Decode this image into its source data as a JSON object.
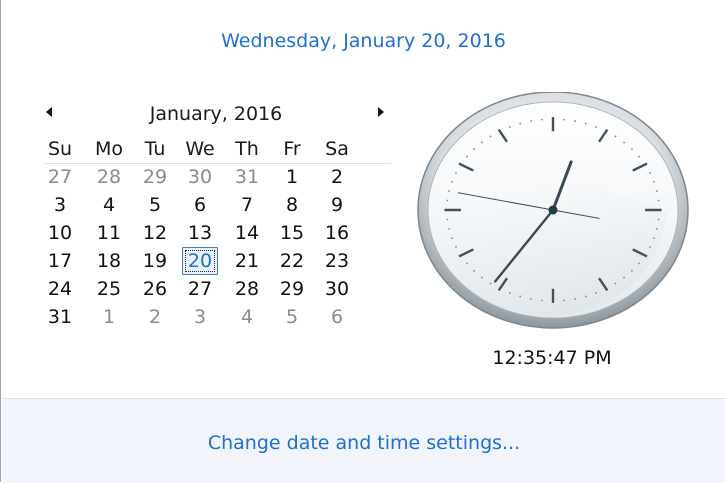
{
  "header": {
    "long_date": "Wednesday, January 20, 2016"
  },
  "calendar": {
    "month_title": "January, 2016",
    "prev_icon": "triangle-left-icon",
    "next_icon": "triangle-right-icon",
    "weekdays": [
      "Su",
      "Mo",
      "Tu",
      "We",
      "Th",
      "Fr",
      "Sa"
    ],
    "weeks": [
      [
        {
          "d": "27",
          "other": true
        },
        {
          "d": "28",
          "other": true
        },
        {
          "d": "29",
          "other": true
        },
        {
          "d": "30",
          "other": true
        },
        {
          "d": "31",
          "other": true
        },
        {
          "d": "1"
        },
        {
          "d": "2"
        }
      ],
      [
        {
          "d": "3"
        },
        {
          "d": "4"
        },
        {
          "d": "5"
        },
        {
          "d": "6"
        },
        {
          "d": "7"
        },
        {
          "d": "8"
        },
        {
          "d": "9"
        }
      ],
      [
        {
          "d": "10"
        },
        {
          "d": "11"
        },
        {
          "d": "12"
        },
        {
          "d": "13"
        },
        {
          "d": "14"
        },
        {
          "d": "15"
        },
        {
          "d": "16"
        }
      ],
      [
        {
          "d": "17"
        },
        {
          "d": "18"
        },
        {
          "d": "19"
        },
        {
          "d": "20",
          "today": true
        },
        {
          "d": "21"
        },
        {
          "d": "22"
        },
        {
          "d": "23"
        }
      ],
      [
        {
          "d": "24"
        },
        {
          "d": "25"
        },
        {
          "d": "26"
        },
        {
          "d": "27"
        },
        {
          "d": "28"
        },
        {
          "d": "29"
        },
        {
          "d": "30"
        }
      ],
      [
        {
          "d": "31"
        },
        {
          "d": "1",
          "other": true
        },
        {
          "d": "2",
          "other": true
        },
        {
          "d": "3",
          "other": true
        },
        {
          "d": "4",
          "other": true
        },
        {
          "d": "5",
          "other": true
        },
        {
          "d": "6",
          "other": true
        }
      ]
    ]
  },
  "clock": {
    "time_text": "12:35:47 PM",
    "hours": 12,
    "minutes": 35,
    "seconds": 47
  },
  "footer": {
    "settings_link": "Change date and time settings..."
  },
  "colors": {
    "link": "#1f6fd1",
    "other_month": "#8b8b8b",
    "footer_bg": "#f1f5fb"
  }
}
